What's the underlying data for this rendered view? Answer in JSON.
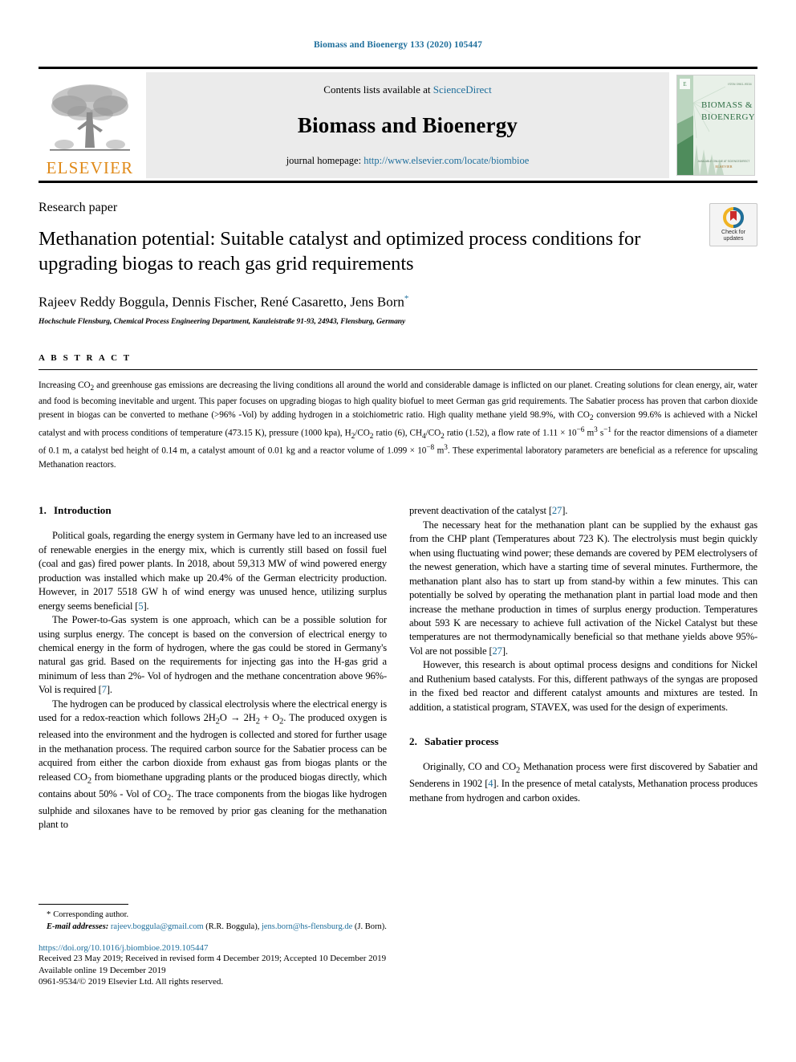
{
  "running_head": "Biomass and Bioenergy 133 (2020) 105447",
  "masthead": {
    "contents_prefix": "Contents lists available at ",
    "contents_link": "ScienceDirect",
    "journal_name": "Biomass and Bioenergy",
    "homepage_prefix": "journal homepage: ",
    "homepage_link": "http://www.elsevier.com/locate/biombioe",
    "publisher_wordmark": "ELSEVIER",
    "cover_title_line1": "BIOMASS &",
    "cover_title_line2": "BIOENERGY"
  },
  "article": {
    "type": "Research paper",
    "title": "Methanation potential: Suitable catalyst and optimized process conditions for upgrading biogas to reach gas grid requirements",
    "authors": "Rajeev Reddy Boggula, Dennis Fischer, René Casaretto, Jens Born",
    "corresponding_marker": "*",
    "affiliation": "Hochschule Flensburg, Chemical Process Engineering Department, Kanzleistraße 91-93, 24943, Flensburg, Germany",
    "crossmark_label_line1": "Check for",
    "crossmark_label_line2": "updates"
  },
  "abstract": {
    "label": "A B S T R A C T",
    "text": "Increasing CO2 and greenhouse gas emissions are decreasing the living conditions all around the world and considerable damage is inflicted on our planet. Creating solutions for clean energy, air, water and food is becoming inevitable and urgent. This paper focuses on upgrading biogas to high quality biofuel to meet German gas grid requirements. The Sabatier process has proven that carbon dioxide present in biogas can be converted to methane (>96% -Vol) by adding hydrogen in a stoichiometric ratio. High quality methane yield 98.9%, with CO2 conversion 99.6% is achieved with a Nickel catalyst and with process conditions of temperature (473.15 K), pressure (1000 kpa), H2/CO2 ratio (6), CH4/CO2 ratio (1.52), a flow rate of 1.11 × 10−6 m3 s−1 for the reactor dimensions of a diameter of 0.1 m, a catalyst bed height of 0.14 m, a catalyst amount of 0.01 kg and a reactor volume of 1.099 × 10−8 m3. These experimental laboratory parameters are beneficial as a reference for upscaling Methanation reactors."
  },
  "sections": {
    "intro": {
      "number": "1.",
      "title": "Introduction",
      "paragraphs": [
        "Political goals, regarding the energy system in Germany have led to an increased use of renewable energies in the energy mix, which is currently still based on fossil fuel (coal and gas) fired power plants. In 2018, about 59,313 MW of wind powered energy production was installed which make up 20.4% of the German electricity production. However, in 2017 5518 GW h of wind energy was unused hence, utilizing surplus energy seems beneficial [5].",
        "The Power-to-Gas system is one approach, which can be a possible solution for using surplus energy. The concept is based on the conversion of electrical energy to chemical energy in the form of hydrogen, where the gas could be stored in Germany's natural gas grid. Based on the requirements for injecting gas into the H-gas grid a minimum of less than 2%- Vol of hydrogen and the methane concentration above 96%- Vol is required [7].",
        "The hydrogen can be produced by classical electrolysis where the electrical energy is used for a redox-reaction which follows 2H2O → 2H2 + O2. The produced oxygen is released into the environment and the hydrogen is collected and stored for further usage in the methanation process. The required carbon source for the Sabatier process can be acquired from either the carbon dioxide from exhaust gas from biogas plants or the released CO2 from biomethane upgrading plants or the produced biogas directly, which contains about 50% - Vol of CO2. The trace components from the biogas like hydrogen sulphide and siloxanes have to be removed by prior gas cleaning for the methanation plant to",
        "prevent deactivation of the catalyst [27].",
        "The necessary heat for the methanation plant can be supplied by the exhaust gas from the CHP plant (Temperatures about 723 K). The electrolysis must begin quickly when using fluctuating wind power; these demands are covered by PEM electrolysers of the newest generation, which have a starting time of several minutes. Furthermore, the methanation plant also has to start up from stand-by within a few minutes. This can potentially be solved by operating the methanation plant in partial load mode and then increase the methane production in times of surplus energy production. Temperatures about 593 K are necessary to achieve full activation of the Nickel Catalyst but these temperatures are not thermodynamically beneficial so that methane yields above 95%- Vol are not possible [27].",
        "However, this research is about optimal process designs and conditions for Nickel and Ruthenium based catalysts. For this, different pathways of the syngas are proposed in the fixed bed reactor and different catalyst amounts and mixtures are tested. In addition, a statistical program, STAVEX, was used for the design of experiments."
      ]
    },
    "sabatier": {
      "number": "2.",
      "title": "Sabatier process",
      "paragraphs": [
        "Originally, CO and CO2 Methanation process were first discovered by Sabatier and Senderens in 1902 [4]. In the presence of metal catalysts, Methanation process produces methane from hydrogen and carbon oxides."
      ]
    }
  },
  "footer": {
    "corresponding_marker": "*",
    "corresponding_text": "Corresponding author.",
    "emails_label": "E-mail addresses:",
    "email1": "rajeev.boggula@gmail.com",
    "email1_owner": "(R.R. Boggula),",
    "email2": "jens.born@hs-flensburg.de",
    "email2_owner": "(J. Born).",
    "doi": "https://doi.org/10.1016/j.biombioe.2019.105447",
    "history": "Received 23 May 2019; Received in revised form 4 December 2019; Accepted 10 December 2019",
    "available": "Available online 19 December 2019",
    "copyright": "0961-9534/© 2019 Elsevier Ltd. All rights reserved."
  },
  "colors": {
    "link": "#1f6f9c",
    "elsevier_orange": "#e08a19",
    "masthead_bg": "#ebebeb"
  }
}
